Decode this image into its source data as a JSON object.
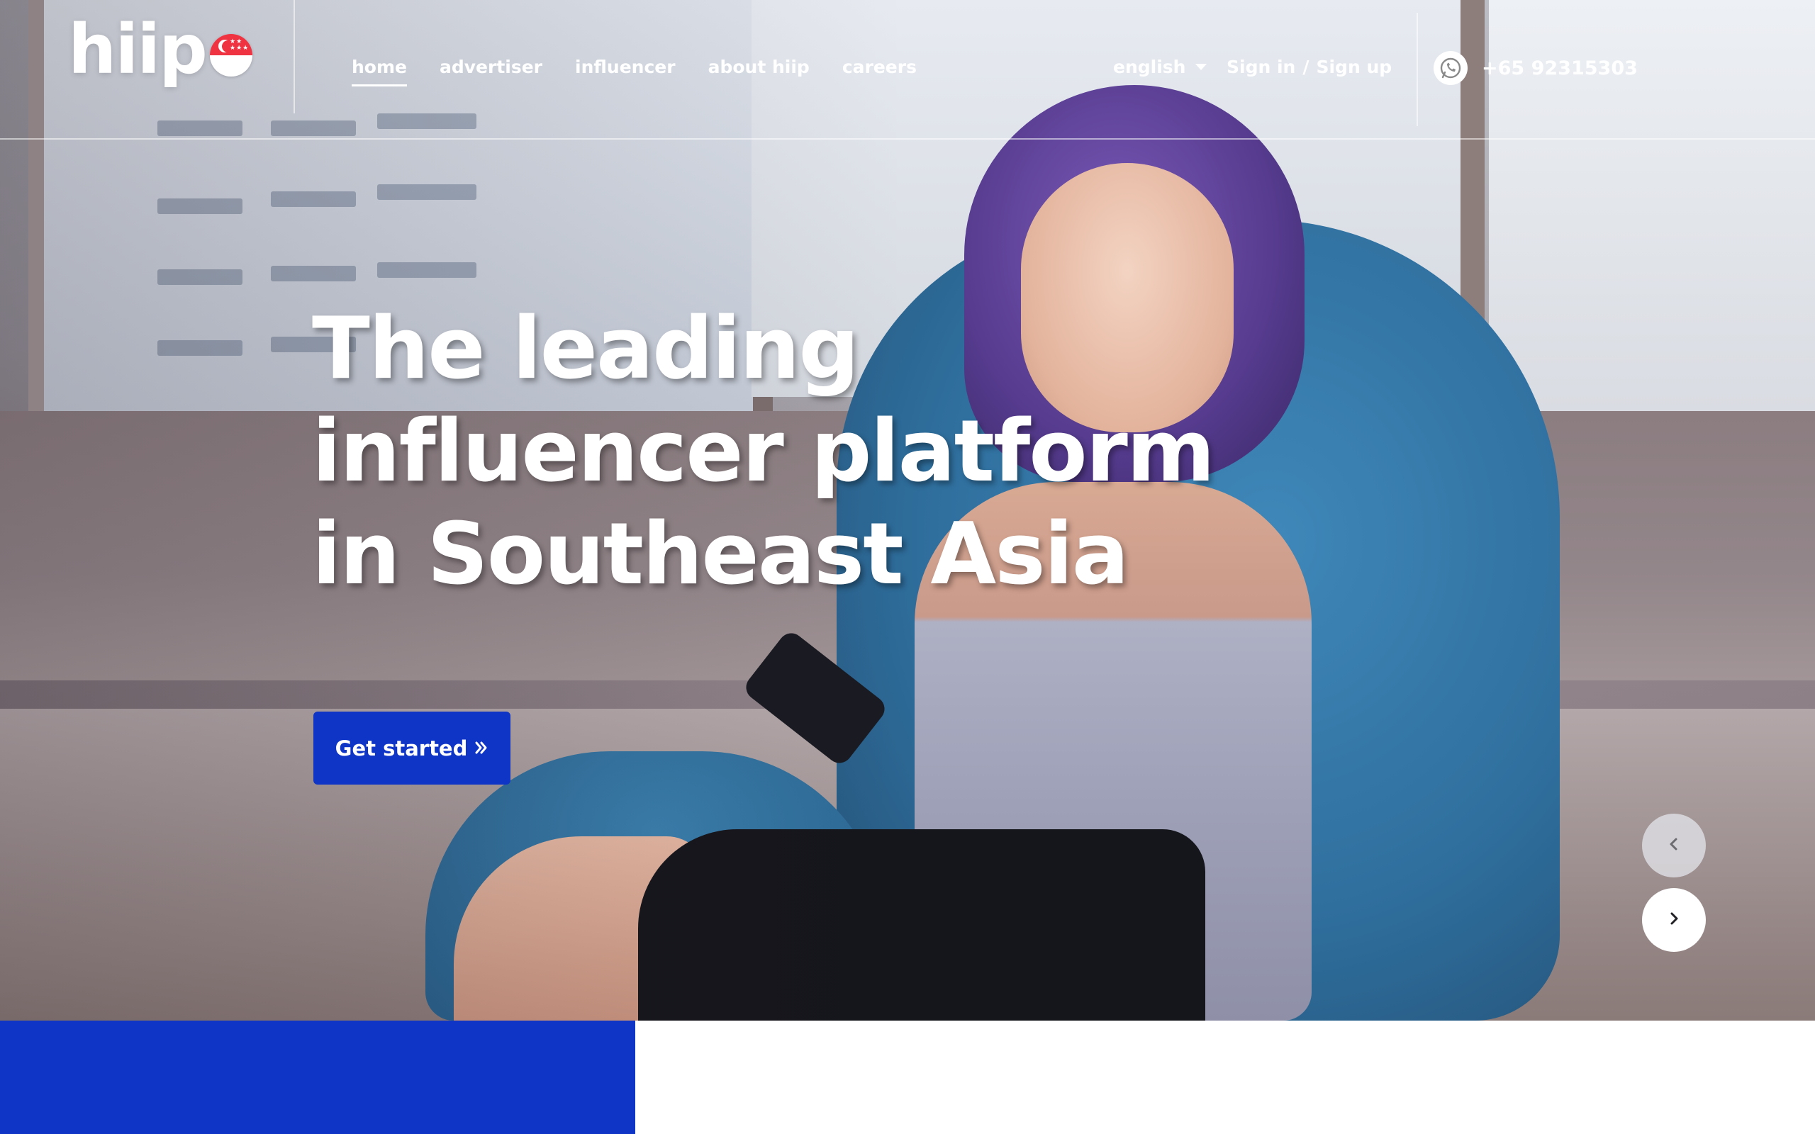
{
  "brand": {
    "logo_text": "hiip",
    "country_flag_icon": "singapore-flag-icon"
  },
  "nav": {
    "items": [
      {
        "label": "home",
        "active": true
      },
      {
        "label": "advertiser",
        "active": false
      },
      {
        "label": "influencer",
        "active": false
      },
      {
        "label": "about hiip",
        "active": false
      },
      {
        "label": "careers",
        "active": false
      }
    ]
  },
  "language": {
    "selected": "english",
    "icon": "caret-down-icon"
  },
  "auth": {
    "sign_in": "Sign in",
    "separator": "/",
    "sign_up": "Sign up"
  },
  "contact": {
    "icon": "whatsapp-icon",
    "phone": "+65 92315303"
  },
  "hero": {
    "headline_lines": [
      "The leading",
      "influencer platform",
      "in Southeast Asia"
    ],
    "cta_label": "Get started",
    "cta_icon": "double-chevron-right-icon",
    "prev_icon": "chevron-left-icon",
    "next_icon": "chevron-right-icon"
  },
  "colors": {
    "primary_blue": "#0f35c6",
    "white": "#ffffff",
    "flag_red": "#ef3340"
  }
}
